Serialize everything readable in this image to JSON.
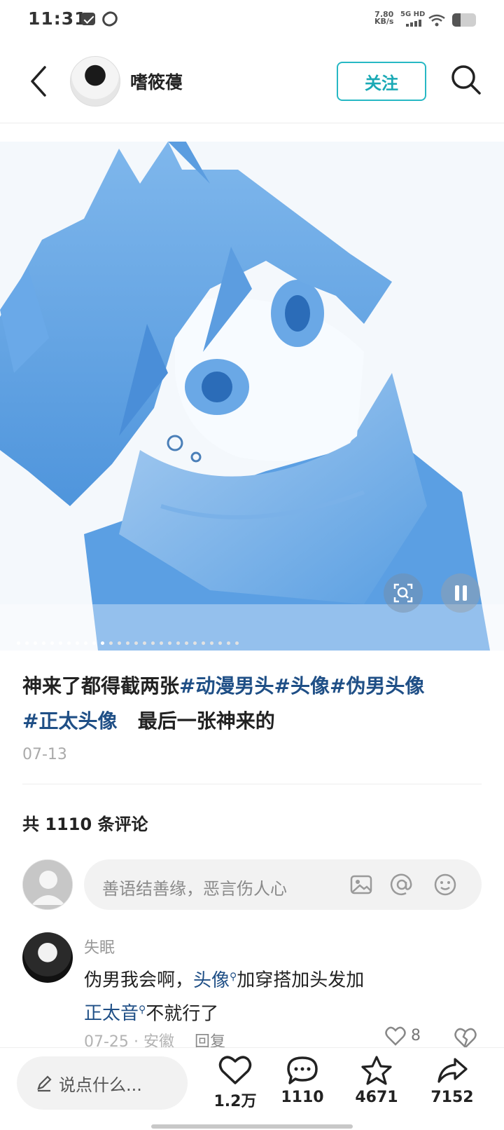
{
  "status_bar": {
    "time": "11:31",
    "net_speed_top": "7.80",
    "net_speed_unit": "KB/s",
    "network": "5G HD",
    "battery_level": 0.35
  },
  "header": {
    "author_name": "嗜筱葠",
    "follow_label": "关注"
  },
  "post": {
    "caption_text": "神来了都得截两张",
    "tags": [
      "#动漫男头",
      "#头像",
      "#伪男头像",
      "#正太头像"
    ],
    "caption_tail": "最后一张神来的",
    "date": "07-13",
    "image_count": 27,
    "current_image": 0
  },
  "comments": {
    "count_label": "共 1110 条评论",
    "input_placeholder": "善语结善缘，恶言伤人心",
    "items": [
      {
        "user": "失眠",
        "text_a": "伪男我会啊，",
        "link_1": "头像",
        "text_b": "加穿搭加头发加",
        "link_2": "正太音",
        "text_c": "不就行了",
        "date": "07-25",
        "location": "安徽",
        "reply_label": "回复",
        "likes": "8"
      }
    ]
  },
  "bottom_bar": {
    "say_placeholder": "说点什么...",
    "likes": "1.2万",
    "comments": "1110",
    "stars": "4671",
    "shares": "7152"
  }
}
